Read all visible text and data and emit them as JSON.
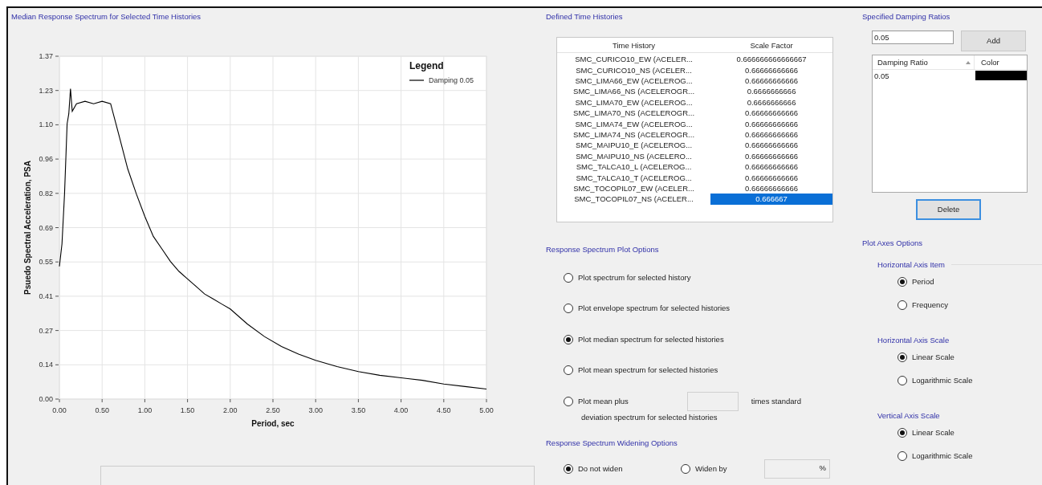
{
  "chart_panel": {
    "title": "Median Response Spectrum for Selected Time Histories",
    "legend": {
      "title": "Legend"
    },
    "chart_data": {
      "type": "line",
      "grid": true,
      "xlabel": "Period, sec",
      "ylabel": "Psuedo Spectral Acceleration, PSA",
      "x": [
        0,
        0.03,
        0.06,
        0.09,
        0.11,
        0.13,
        0.15,
        0.2,
        0.3,
        0.4,
        0.5,
        0.6,
        0.7,
        0.8,
        0.9,
        1.0,
        1.1,
        1.2,
        1.3,
        1.4,
        1.5,
        1.6,
        1.7,
        1.8,
        1.9,
        2.0,
        2.2,
        2.4,
        2.6,
        2.8,
        3.0,
        3.25,
        3.5,
        3.75,
        4.0,
        4.25,
        4.5,
        4.75,
        5.0
      ],
      "series": [
        {
          "name": "Damping 0.05",
          "color": "#000000",
          "values": [
            0.53,
            0.62,
            0.82,
            1.1,
            1.14,
            1.24,
            1.15,
            1.18,
            1.19,
            1.18,
            1.19,
            1.18,
            1.05,
            0.92,
            0.82,
            0.73,
            0.65,
            0.6,
            0.55,
            0.51,
            0.48,
            0.45,
            0.42,
            0.4,
            0.38,
            0.36,
            0.3,
            0.25,
            0.21,
            0.18,
            0.155,
            0.13,
            0.11,
            0.095,
            0.085,
            0.075,
            0.06,
            0.05,
            0.04
          ]
        }
      ],
      "xlim": [
        0,
        5
      ],
      "ylim": [
        0,
        1.37
      ],
      "xticks": [
        {
          "value": 0,
          "label": "0.00"
        },
        {
          "value": 0.5,
          "label": "0.50"
        },
        {
          "value": 1,
          "label": "1.00"
        },
        {
          "value": 1.5,
          "label": "1.50"
        },
        {
          "value": 2,
          "label": "2.00"
        },
        {
          "value": 2.5,
          "label": "2.50"
        },
        {
          "value": 3,
          "label": "3.00"
        },
        {
          "value": 3.5,
          "label": "3.50"
        },
        {
          "value": 4,
          "label": "4.00"
        },
        {
          "value": 4.5,
          "label": "4.50"
        },
        {
          "value": 5,
          "label": "5.00"
        }
      ],
      "yticks": [
        {
          "value": 0,
          "label": "0.00"
        },
        {
          "value": 0.137,
          "label": "0.14"
        },
        {
          "value": 0.274,
          "label": "0.27"
        },
        {
          "value": 0.411,
          "label": "0.41"
        },
        {
          "value": 0.548,
          "label": "0.55"
        },
        {
          "value": 0.685,
          "label": "0.69"
        },
        {
          "value": 0.822,
          "label": "0.82"
        },
        {
          "value": 0.959,
          "label": "0.96"
        },
        {
          "value": 1.096,
          "label": "1.10"
        },
        {
          "value": 1.233,
          "label": "1.23"
        },
        {
          "value": 1.37,
          "label": "1.37"
        }
      ]
    }
  },
  "time_histories": {
    "title": "Defined Time Histories",
    "columns": [
      "Time History",
      "Scale Factor"
    ],
    "rows": [
      {
        "name": "SMC_CURICO10_EW (ACELER...",
        "scale": "0.666666666666667",
        "selected": false
      },
      {
        "name": "SMC_CURICO10_NS (ACELER...",
        "scale": "0.66666666666",
        "selected": false
      },
      {
        "name": "SMC_LIMA66_EW (ACELEROG...",
        "scale": "0.66666666666",
        "selected": false
      },
      {
        "name": "SMC_LIMA66_NS (ACELEROGR...",
        "scale": "0.6666666666",
        "selected": false
      },
      {
        "name": "SMC_LIMA70_EW (ACELEROG...",
        "scale": "0.6666666666",
        "selected": false
      },
      {
        "name": "SMC_LIMA70_NS (ACELEROGR...",
        "scale": "0.66666666666",
        "selected": false
      },
      {
        "name": "SMC_LIMA74_EW (ACELEROG...",
        "scale": "0.66666666666",
        "selected": false
      },
      {
        "name": "SMC_LIMA74_NS (ACELEROGR...",
        "scale": "0.66666666666",
        "selected": false
      },
      {
        "name": "SMC_MAIPU10_E (ACELEROG...",
        "scale": "0.66666666666",
        "selected": false
      },
      {
        "name": "SMC_MAIPU10_NS (ACELERO...",
        "scale": "0.66666666666",
        "selected": false
      },
      {
        "name": "SMC_TALCA10_L (ACELEROG...",
        "scale": "0.66666666666",
        "selected": false
      },
      {
        "name": "SMC_TALCA10_T (ACELEROG...",
        "scale": "0.66666666666",
        "selected": false
      },
      {
        "name": "SMC_TOCOPIL07_EW (ACELER...",
        "scale": "0.66666666666",
        "selected": false
      },
      {
        "name": "SMC_TOCOPIL07_NS (ACELER...",
        "scale": "0.666667",
        "selected": true
      }
    ]
  },
  "plot_options": {
    "title": "Response Spectrum Plot Options",
    "options": [
      {
        "kind": "simple",
        "label": "Plot spectrum for selected history",
        "selected": false
      },
      {
        "kind": "simple",
        "label": "Plot envelope spectrum for selected histories",
        "selected": false
      },
      {
        "kind": "simple",
        "label": "Plot median spectrum for selected histories",
        "selected": true
      },
      {
        "kind": "simple",
        "label": "Plot mean spectrum for selected histories",
        "selected": false
      },
      {
        "kind": "mean_plus",
        "label": "Plot mean plus",
        "suffix": "times standard",
        "continuation": "deviation spectrum for selected histories",
        "selected": false
      }
    ]
  },
  "widening": {
    "title": "Response Spectrum Widening Options",
    "options": [
      {
        "label": "Do not widen",
        "selected": true
      },
      {
        "label": "Widen by",
        "selected": false
      }
    ],
    "unit": "%"
  },
  "damping": {
    "title": "Specified Damping Ratios",
    "input_value": "0.05",
    "add_button": "Add",
    "columns": [
      "Damping Ratio",
      "Color"
    ],
    "rows": [
      {
        "ratio": "0.05",
        "color": "#000000"
      }
    ],
    "delete_button": "Delete"
  },
  "axes": {
    "title": "Plot Axes Options",
    "groups": [
      {
        "title": "Horizontal Axis Item",
        "options": [
          {
            "label": "Period",
            "selected": true
          },
          {
            "label": "Frequency",
            "selected": false
          }
        ]
      },
      {
        "title": "Horizontal Axis Scale",
        "options": [
          {
            "label": "Linear Scale",
            "selected": true
          },
          {
            "label": "Logarithmic Scale",
            "selected": false
          }
        ]
      },
      {
        "title": "Vertical Axis Scale",
        "options": [
          {
            "label": "Linear Scale",
            "selected": true
          },
          {
            "label": "Logarithmic Scale",
            "selected": false
          }
        ]
      }
    ]
  }
}
